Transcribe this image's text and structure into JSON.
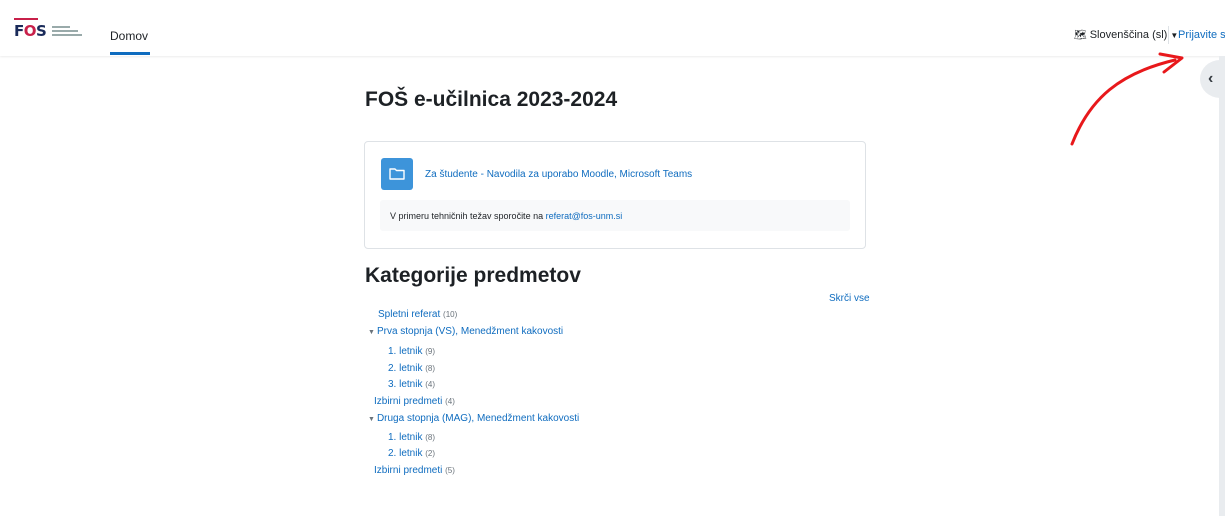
{
  "header": {
    "home_label": "Domov",
    "language_label": "Slovenščina (sl)",
    "login_label": "Prijavite se"
  },
  "main": {
    "page_title": "FOŠ e-učilnica 2023-2024",
    "activity_link": "Za študente - Navodila za uporabo Moodle, Microsoft Teams",
    "notice_text": "V primeru tehničnih težav sporočite na ",
    "notice_email": "referat@fos-unm.si",
    "categories_title": "Kategorije predmetov",
    "collapse_all": "Skrči vse",
    "categories": [
      {
        "label": "Spletni referat",
        "count": "(10)"
      },
      {
        "label": "Prva stopnja (VS), Menedžment kakovosti"
      },
      {
        "label": "1. letnik",
        "count": "(9)"
      },
      {
        "label": "2. letnik",
        "count": "(8)"
      },
      {
        "label": "3. letnik",
        "count": "(4)"
      },
      {
        "label": "Izbirni predmeti",
        "count": "(4)"
      },
      {
        "label": "Druga stopnja (MAG), Menedžment kakovosti"
      },
      {
        "label": "1. letnik",
        "count": "(8)"
      },
      {
        "label": "2. letnik",
        "count": "(2)"
      },
      {
        "label": "Izbirni predmeti",
        "count": "(5)"
      }
    ]
  },
  "colors": {
    "link": "#0f6cbf",
    "folder_icon_bg": "#3d94da",
    "annotation_arrow": "#e8181b"
  }
}
